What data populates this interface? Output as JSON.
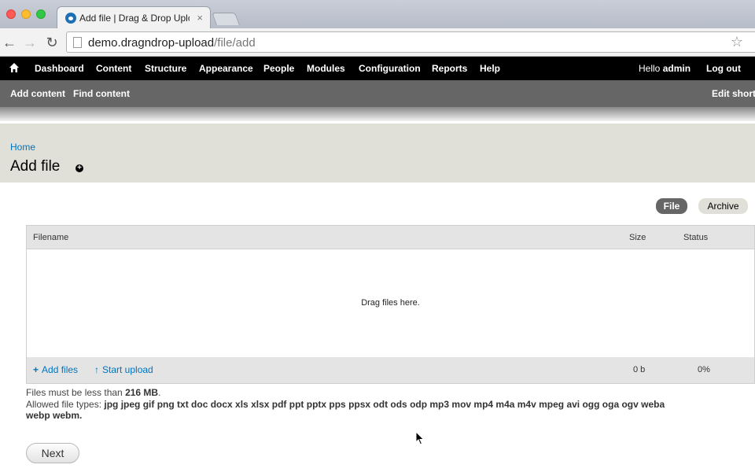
{
  "browser": {
    "tab_title": "Add file | Drag & Drop Upload",
    "tab_close": "×",
    "url_host": "demo.dragndrop-upload",
    "url_path": "/file/add"
  },
  "admin_menu": {
    "items": [
      "Dashboard",
      "Content",
      "Structure",
      "Appearance",
      "People",
      "Modules",
      "Configuration",
      "Reports",
      "Help"
    ],
    "hello_prefix": "Hello ",
    "username": "admin",
    "logout": "Log out"
  },
  "shortcuts": {
    "items": [
      "Add content",
      "Find content"
    ],
    "edit": "Edit shortcuts"
  },
  "page": {
    "breadcrumb": "Home",
    "title": "Add file"
  },
  "tabs": [
    "File",
    "Archive"
  ],
  "upload": {
    "columns": {
      "filename": "Filename",
      "size": "Size",
      "status": "Status"
    },
    "dropzone": "Drag files here.",
    "add_files": "Add files",
    "start_upload": "Start upload",
    "total_size": "0 b",
    "total_progress": "0%"
  },
  "help": {
    "size_prefix": "Files must be less than ",
    "size_limit": "216 MB",
    "size_suffix": ".",
    "types_prefix": "Allowed file types: ",
    "types_line1": "jpg jpeg gif png txt doc docx xls xlsx pdf ppt pptx pps ppsx odt ods odp mp3 mov mp4 m4a m4v mpeg avi ogg oga ogv weba",
    "types_line2": "webp webm."
  },
  "actions": {
    "next": "Next"
  },
  "colors": {
    "link": "#0074bd",
    "admin_bar": "#000000",
    "shortcut_bar": "#666666",
    "header_bg": "#e0e0d8"
  }
}
